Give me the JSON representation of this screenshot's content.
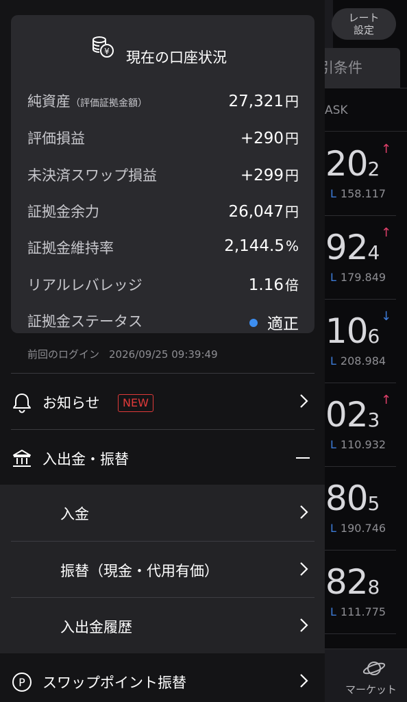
{
  "background": {
    "rate_settings_label": "レート\n設定",
    "conditions_tab_label": "引条件",
    "ask_header": "ASK",
    "quotes": [
      {
        "main": ".20",
        "sub": "2",
        "low": "158.117",
        "direction": "up"
      },
      {
        "main": ".92",
        "sub": "4",
        "low": "179.849",
        "direction": "up"
      },
      {
        "main": ".10",
        "sub": "6",
        "low": "208.984",
        "direction": "down"
      },
      {
        "main": ".02",
        "sub": "3",
        "low": "110.932",
        "direction": "up"
      },
      {
        "main": ".80",
        "sub": "5",
        "low": "190.746",
        "direction": "none"
      },
      {
        "main": ".82",
        "sub": "8",
        "low": "111.775",
        "direction": "none"
      }
    ],
    "low_prefix": "L",
    "nav_market_label": "マーケット",
    "colors": {
      "up": "#e0406a",
      "down": "#3d7bd8"
    }
  },
  "account_card": {
    "title": "現在の口座状況",
    "title_icon": "coins-yen-icon",
    "rows": [
      {
        "label": "純資産",
        "label_note": "（評価証拠金額）",
        "value": "27,321",
        "unit": "円"
      },
      {
        "label": "評価損益",
        "value": "+290",
        "unit": "円"
      },
      {
        "label": "未決済スワップ損益",
        "value": "+299",
        "unit": "円"
      },
      {
        "label": "証拠金余力",
        "value": "26,047",
        "unit": "円"
      },
      {
        "label": "証拠金維持率",
        "value": "2,144.5",
        "unit": "%"
      },
      {
        "label": "リアルレバレッジ",
        "value": "1.16",
        "unit": "倍"
      },
      {
        "label": "証拠金ステータス",
        "value": "適正",
        "status_color": "#3d8ef0"
      }
    ]
  },
  "last_login": {
    "label": "前回のログイン",
    "datetime": "2026/09/25 09:39:49"
  },
  "menu": {
    "notice": {
      "label": "お知らせ",
      "badge": "NEW",
      "icon": "bell-icon"
    },
    "deposit_transfer": {
      "label": "入出金・振替",
      "icon": "bank-icon",
      "expanded": true
    },
    "sub_items": [
      {
        "label": "入金"
      },
      {
        "label": "振替（現金・代用有価）"
      },
      {
        "label": "入出金履歴"
      }
    ],
    "swap_point": {
      "label": "スワップポイント振替",
      "icon": "p-circle-icon"
    }
  }
}
